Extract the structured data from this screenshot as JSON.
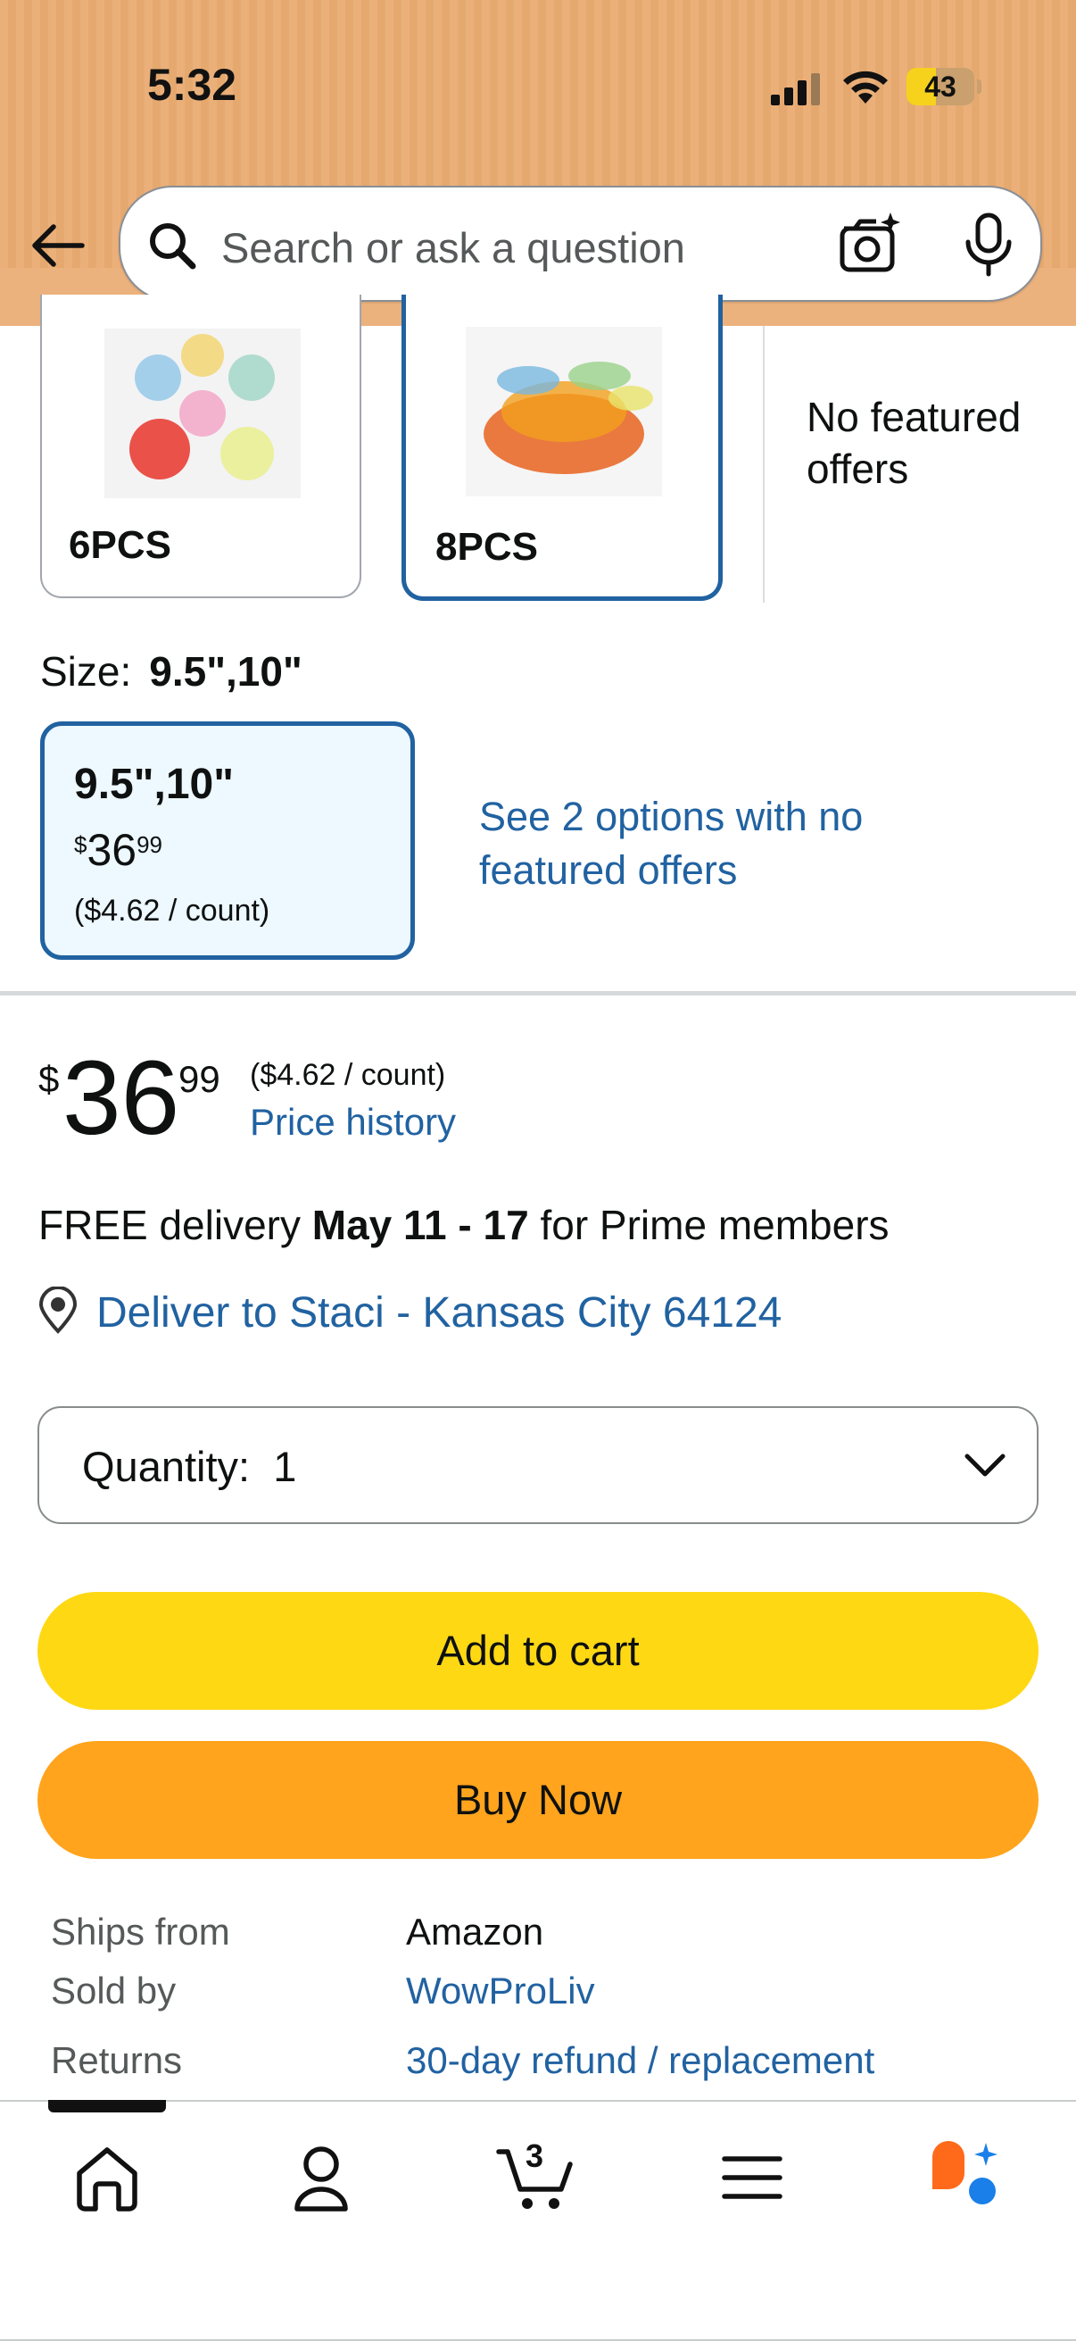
{
  "status_bar": {
    "time": "5:32",
    "battery": "43",
    "battery_level_percent": 43
  },
  "header": {
    "search_placeholder": "Search or ask a question"
  },
  "variants": {
    "tiles": [
      {
        "label": "6PCS",
        "selected": false
      },
      {
        "label": "8PCS",
        "selected": true
      }
    ],
    "no_offers_text": "No featured offers"
  },
  "size": {
    "label": "Size:",
    "selected_value": "9.5\",10\"",
    "tile": {
      "name": "9.5\",10\"",
      "currency": "$",
      "price_whole": "36",
      "price_fraction": "99",
      "unit_price": "($4.62 / count)"
    },
    "options_link": "See 2 options with no featured offers"
  },
  "price": {
    "currency": "$",
    "whole": "36",
    "fraction": "99",
    "unit_price": "($4.62 / count)",
    "history_link": "Price history"
  },
  "delivery": {
    "prefix": "FREE delivery",
    "dates": "May 11 - 17",
    "suffix": "for Prime members",
    "deliver_to": "Deliver to Staci - Kansas City 64124"
  },
  "quantity": {
    "label": "Quantity:",
    "value": "1"
  },
  "buttons": {
    "add_to_cart": "Add to cart",
    "buy_now": "Buy Now"
  },
  "info": {
    "ships_from_label": "Ships from",
    "ships_from_value": "Amazon",
    "sold_by_label": "Sold by",
    "sold_by_value": "WowProLiv",
    "returns_label": "Returns",
    "returns_value": "30-day refund / replacement"
  },
  "bottom_nav": {
    "cart_count": "3",
    "items": [
      "home-icon",
      "account-icon",
      "cart-icon",
      "menu-icon",
      "rufus-icon"
    ]
  },
  "colors": {
    "header_bg": "#ebb07a",
    "link": "#2162a1",
    "add_to_cart": "#ffd814",
    "buy_now": "#ffa41c",
    "selected_border": "#2162a1"
  }
}
